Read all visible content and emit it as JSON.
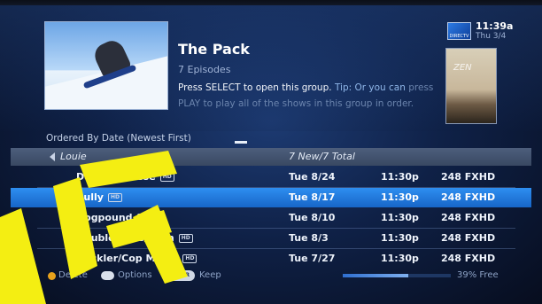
{
  "header": {
    "title": "The Pack",
    "episodes": "7 Episodes",
    "desc_main": "Press SELECT to open this group.",
    "desc_tip": "Tip: Or you can",
    "desc_fade1": "press PLAY to play all of the shows in this group",
    "desc_fade2": "in order.",
    "clock": "11:39a",
    "date": "Thu 3/4",
    "logo_text": "DIRECTV",
    "poster_text": "ZEN"
  },
  "list": {
    "sort_label": "Ordered By Date (Newest First)",
    "group": {
      "name": "Louie",
      "total": "7 New/7 Total"
    },
    "rows": [
      {
        "title": "Dentist/Tarese",
        "hd": "HD",
        "date": "Tue 8/24",
        "time": "11:30p",
        "channel": "248 FXHD",
        "selected": false
      },
      {
        "title": "Bully",
        "hd": "HD",
        "date": "Tue 8/17",
        "time": "11:30p",
        "channel": "248 FXHD",
        "selected": true
      },
      {
        "title": "Dogpound",
        "hd": "HD",
        "date": "Tue 8/10",
        "time": "11:30p",
        "channel": "248 FXHD",
        "selected": false
      },
      {
        "title": "Double Date/Mom",
        "hd": "HD",
        "date": "Tue 8/3",
        "time": "11:30p",
        "channel": "248 FXHD",
        "selected": false
      },
      {
        "title": "Heckler/Cop Movie",
        "hd": "HD",
        "date": "Tue 7/27",
        "time": "11:30p",
        "channel": "248 FXHD",
        "selected": false
      }
    ]
  },
  "footer": {
    "delete_label": "Delete",
    "options_label": "Options",
    "enter_label": "ENTER",
    "keep_label": "Keep",
    "storage_used_fraction": 0.61,
    "free_label": "39% Free"
  },
  "colors": {
    "selection": "#2e8ef0",
    "overlay_yellow": "#f4ee12",
    "delete_button": "#e8a21c"
  }
}
